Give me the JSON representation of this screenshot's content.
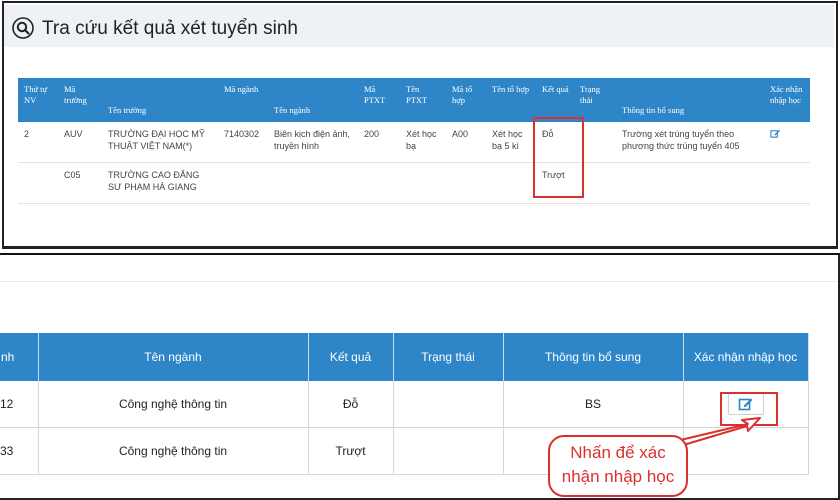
{
  "top": {
    "title": "Tra cứu kết quả xét tuyển sinh",
    "columns": [
      "Thứ tự NV",
      "Mã trường",
      "Tên trường",
      "Mã ngành",
      "Tên ngành",
      "Mã PTXT",
      "Tên PTXT",
      "Mã tổ hợp",
      "Tên tổ hợp",
      "Kết quả",
      "Trạng thái",
      "Thông tin bổ sung",
      "Xác nhận nhập học"
    ],
    "rows": [
      {
        "stt": "2",
        "ma_truong": "AUV",
        "ten_truong": "TRƯỜNG ĐẠI HỌC MỸ THUẬT VIỆT NAM(*)",
        "ma_nganh": "7140302",
        "ten_nganh": "Biên kịch điện ảnh, truyền hình",
        "ma_ptxt": "200",
        "ten_ptxt": "Xét học bạ",
        "ma_to_hop": "A00",
        "ten_to_hop": "Xét học bạ 5 kì",
        "ket_qua": "Đỗ",
        "trang_thai": "",
        "thong_tin": "Trường xét trúng tuyển theo phương thức trúng tuyển 405"
      },
      {
        "stt": "",
        "ma_truong": "C05",
        "ten_truong": "TRƯỜNG CAO ĐẲNG SƯ PHẠM HÀ GIANG",
        "ma_nganh": "",
        "ten_nganh": "",
        "ma_ptxt": "",
        "ten_ptxt": "",
        "ma_to_hop": "",
        "ten_to_hop": "",
        "ket_qua": "Trượt",
        "trang_thai": "",
        "thong_tin": ""
      }
    ]
  },
  "bottom": {
    "columns": [
      "nh",
      "Tên ngành",
      "Kết quả",
      "Trạng thái",
      "Thông tin bổ sung",
      "Xác nhận nhập học"
    ],
    "rows": [
      {
        "code": "12",
        "ten_nganh": "Công nghệ thông tin",
        "ket_qua": "Đỗ",
        "trang_thai": "",
        "thong_tin": "BS"
      },
      {
        "code": "33",
        "ten_nganh": "Công nghệ thông tin",
        "ket_qua": "Trượt",
        "trang_thai": "",
        "thong_tin": ""
      }
    ],
    "callout": "Nhấn để xác nhận nhập học"
  },
  "colors": {
    "accent": "#2e86c9",
    "highlight": "#d9312f"
  },
  "icons": {
    "title": "search-icon",
    "edit": "edit-icon"
  }
}
